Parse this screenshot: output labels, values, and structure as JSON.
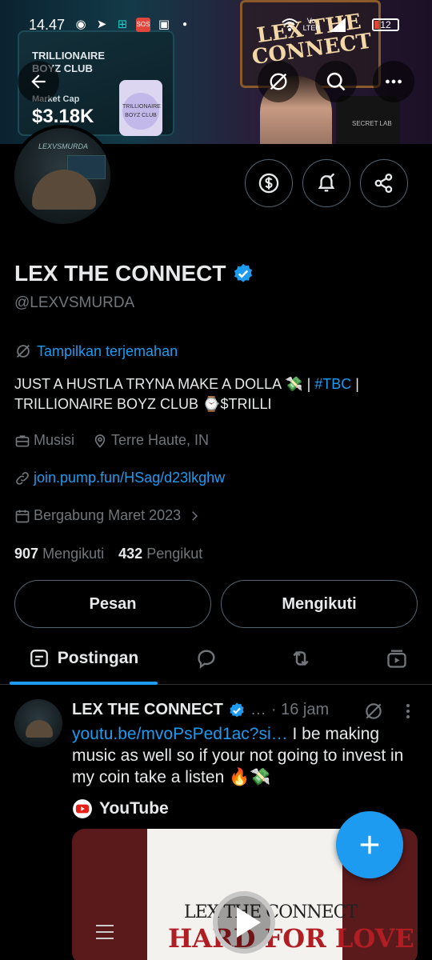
{
  "status_bar": {
    "time": "14.47",
    "battery": "12",
    "network": "Vo LTE0"
  },
  "banner": {
    "screen_title": "TRILLIONAIRE BOYZ CLUB",
    "market_cap_label": "Market Cap",
    "market_cap_value": "$3.18K",
    "coin_text": "TRILLIONAIRE BOYZ CLUB",
    "neon_sign": "LEX THE CONNECT",
    "chair_text": "SECRET LAB",
    "avatar_text": "LEXVSMURDA"
  },
  "profile": {
    "display_name": "LEX THE CONNECT",
    "handle": "@LEXVSMURDA",
    "translate_label": "Tampilkan terjemahan",
    "bio_part1": "JUST A HUSTLA TRYNA MAKE A DOLLA 💸 | ",
    "bio_hashtag": "#TBC",
    "bio_part2": " | TRILLIONAIRE BOYZ CLUB ⌚$TRILLI",
    "category": "Musisi",
    "location": "Terre Haute, IN",
    "website": "join.pump.fun/HSag/d23lkghw",
    "joined": "Bergabung Maret 2023",
    "following_count": "907",
    "following_label": "Mengikuti",
    "followers_count": "432",
    "followers_label": "Pengikut"
  },
  "actions": {
    "message_label": "Pesan",
    "following_button_label": "Mengikuti"
  },
  "tabs": {
    "posts_label": "Postingan"
  },
  "post": {
    "author": "LEX THE CONNECT",
    "ellipsis": "…",
    "time": "· 16 jam",
    "link": "youtu.be/mvoPsPed1ac?si…",
    "text": " I be making music as well so if your not going to invest in my coin take a listen 🔥💸",
    "source": "YouTube",
    "card_line1": "LEX THE CONNECT",
    "card_line2": "HARD FOR LOVE"
  },
  "colors": {
    "accent": "#1d9bf0",
    "muted": "#71767b",
    "border": "#536471",
    "background": "#000000"
  }
}
